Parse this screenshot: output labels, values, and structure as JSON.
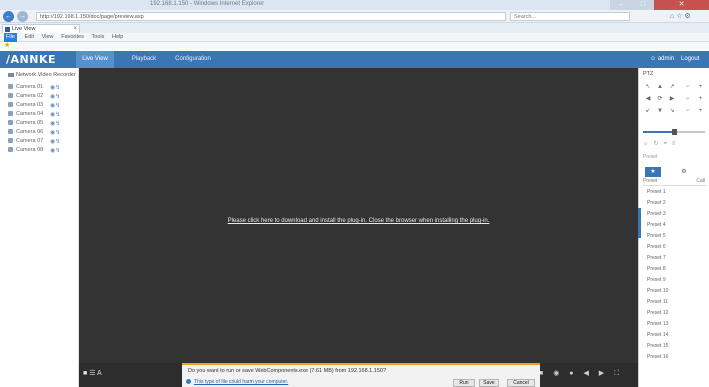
{
  "browser": {
    "window_caption": "192.168.1.150 - Windows Internet Explorer",
    "address": "http://192.168.1.150/doc/page/preview.asp",
    "search_placeholder": "Search...",
    "tab_label": "Live View",
    "menus": [
      "File",
      "Edit",
      "View",
      "Favorites",
      "Tools",
      "Help"
    ]
  },
  "app": {
    "logo": "/ANNKE",
    "nav_tabs": [
      "Live View",
      "Playback",
      "Configuration"
    ],
    "user": "admin",
    "logout": "Logout"
  },
  "left_panel": {
    "device_root": "Network Video Recorder",
    "cameras": [
      "Camera 01",
      "Camera 02",
      "Camera 03",
      "Camera 04",
      "Camera 05",
      "Camera 06",
      "Camera 07",
      "Camera 08"
    ]
  },
  "video": {
    "plugin_message": "Please click here to download and install the plug-in. Close the browser when installing the plug-in."
  },
  "notification": {
    "text": "Do you want to run or save WebComponents.exe (7.61 MB) from 192.168.1.150?",
    "warning_text": "This type of file could harm your computer.",
    "buttons": [
      "Run",
      "Save",
      "Cancel"
    ]
  },
  "right_panel": {
    "title": "PTZ",
    "ptz_grid": [
      "↖",
      "▲",
      "↗",
      "◀",
      "⟳",
      "▶",
      "↙",
      "▼",
      "↘"
    ],
    "ptz_side": [
      "−",
      "+",
      "−",
      "+",
      "−",
      "+"
    ],
    "subtitle": "Preset",
    "tab_icons": [
      "★",
      "⚙"
    ],
    "preset_header_left": "Preset",
    "preset_header_right": "Call",
    "presets": [
      "Preset 1",
      "Preset 2",
      "Preset 3",
      "Preset 4",
      "Preset 5",
      "Preset 6",
      "Preset 7",
      "Preset 8",
      "Preset 9",
      "Preset 10",
      "Preset 11",
      "Preset 12",
      "Preset 13",
      "Preset 14",
      "Preset 15",
      "Preset 16"
    ],
    "speed_level": 0.5
  },
  "colors": {
    "header": "#3a76b5",
    "video_bg": "#333333",
    "notify_accent": "#f0a020"
  }
}
